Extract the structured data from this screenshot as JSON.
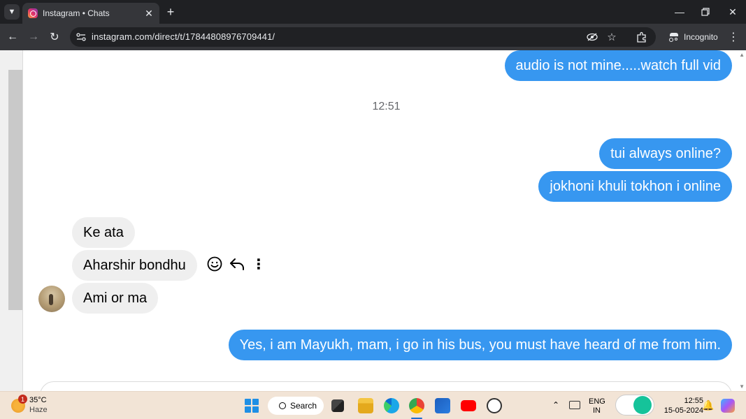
{
  "browser": {
    "tab_title": "Instagram • Chats",
    "url": "instagram.com/direct/t/17844808976709441/",
    "incognito_label": "Incognito"
  },
  "chat": {
    "timestamp": "12:51",
    "messages": [
      {
        "side": "out",
        "text": "audio is not mine.....watch full vid"
      },
      {
        "side": "out",
        "text": "tui always online?"
      },
      {
        "side": "out",
        "text": "jokhoni khuli tokhon i online"
      },
      {
        "side": "in",
        "text": "Ke ata"
      },
      {
        "side": "in",
        "text": "Aharshir bondhu"
      },
      {
        "side": "in",
        "text": "Ami or ma"
      },
      {
        "side": "out",
        "text": "Yes, i am Mayukh, mam, i go in his bus, you must have heard of me from him."
      }
    ]
  },
  "taskbar": {
    "weather_temp": "35°C",
    "weather_desc": "Haze",
    "weather_badge": "1",
    "search_label": "Search",
    "lang_top": "ENG",
    "lang_bottom": "IN",
    "time": "12:55",
    "date": "15-05-2024"
  },
  "colors": {
    "outgoing_bubble": "#3797f0",
    "incoming_bubble": "#efefef",
    "tabbar": "#1f2023",
    "toolbar": "#35363a",
    "taskbar": "#f2e4d6"
  }
}
